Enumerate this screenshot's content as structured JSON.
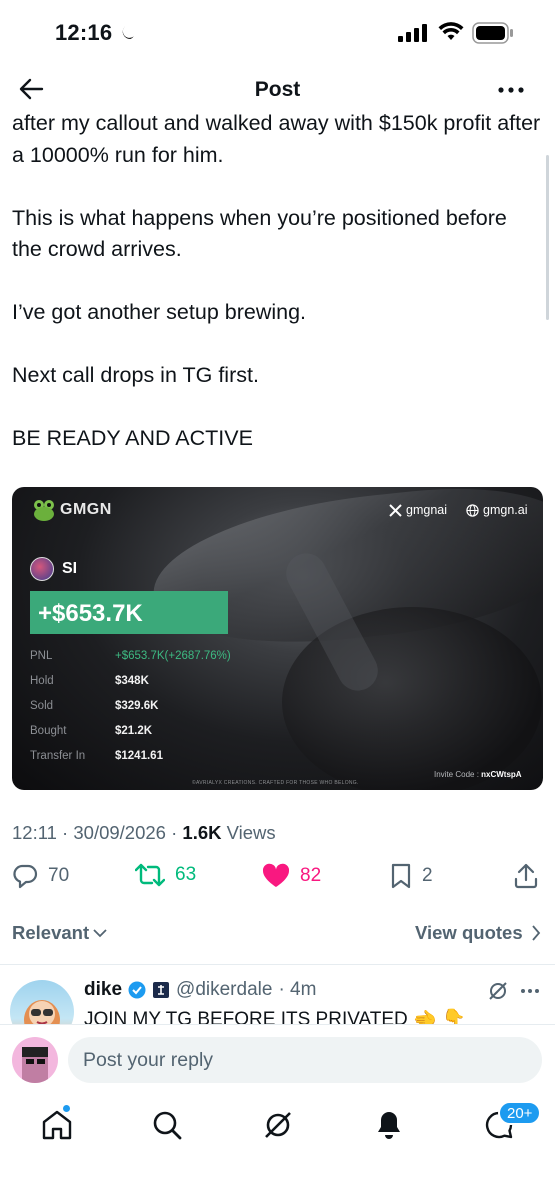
{
  "status_bar": {
    "time": "12:16"
  },
  "header": {
    "title": "Post"
  },
  "tweet": {
    "paragraphs": [
      "after my callout and walked away with $150k profit after a 10000% run for him.",
      "This is what happens when you’re positioned before the crowd arrives.",
      "I’ve got another setup brewing.",
      "Next call drops in TG first.",
      "BE READY AND ACTIVE"
    ],
    "timestamp": "12:11 · 30/09/2026 · ",
    "views_count": "1.6K",
    "views_label": " Views"
  },
  "card": {
    "brand": "GMGN",
    "x_handle": "gmgnai",
    "website": "gmgn.ai",
    "token": "SI",
    "pnl_headline": "+$653.7K",
    "stats": [
      {
        "label": "PNL",
        "value": "+$653.7K(+2687.76%)"
      },
      {
        "label": "Hold",
        "value": "$348K"
      },
      {
        "label": "Sold",
        "value": "$329.6K"
      },
      {
        "label": "Bought",
        "value": "$21.2K"
      },
      {
        "label": "Transfer In",
        "value": "$1241.61"
      }
    ],
    "invite_label": "Invite Code : ",
    "invite_code": "nxCWtspA",
    "footer_note": "©AVRIALYX CREATIONS. CRAFTED FOR THOSE WHO BELONG."
  },
  "actions": {
    "replies": "70",
    "reposts": "63",
    "likes": "82",
    "bookmarks": "2"
  },
  "sort": {
    "relevant": "Relevant",
    "view_quotes": "View quotes"
  },
  "reply": {
    "name": "dike",
    "handle": "@dikerdale",
    "time": "· 4m",
    "text": "JOIN MY TG BEFORE ITS PRIVATED 🫲 👇"
  },
  "composer": {
    "placeholder": "Post your reply"
  },
  "tabbar": {
    "messages_badge": "20+"
  },
  "colors": {
    "accent": "#1d9bf0",
    "repost": "#00ba7c",
    "like": "#f91880",
    "pnl_green": "#3ba97a"
  }
}
